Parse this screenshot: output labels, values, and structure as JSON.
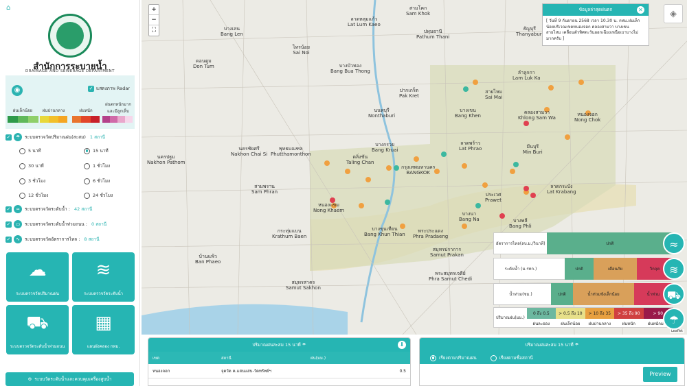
{
  "sidebar": {
    "org_th": "สำนักการระบายน้ำ",
    "org_en": "DRAINAGE AND SEWERAGE DEPARTMENT",
    "radar_toggle": "แสดงภาพ Radar",
    "legend": [
      "ฝนเล็กน้อย",
      "ฝนปานกลาง",
      "ฝนหนัก",
      "ฝนตกหนักมาก และมีลูกเห็บ"
    ],
    "rain_station": {
      "label": "ระบบตรวจวัดปริมาณฝน(สะสม)",
      "count": "1 สถานี"
    },
    "intervals": [
      "5 นาที",
      "15 นาที",
      "30 นาที",
      "1 ชั่วโมง",
      "3 ชั่วโมง",
      "6 ชั่วโมง",
      "12 ชั่วโมง",
      "24 ชั่วโมง"
    ],
    "water_level": {
      "label": "ระบบตรวจวัดระดับน้ำ :",
      "count": "42 สถานี"
    },
    "flood_level": {
      "label": "ระบบตรวจวัดระดับน้ำท่วมถนน :",
      "count": "0 สถานี"
    },
    "flow_rate": {
      "label": "ระบบตรวจวัดอัตราการไหล :",
      "count": "8 สถานี"
    },
    "tiles": [
      "ระบบตรวจวัดปริมาณฝน",
      "ระบบตรวจวัดระดับน้ำ",
      "ระบบตรวจวัดระดับน้ำท่วมถนน",
      "แผนผังคลอง กทม."
    ],
    "bottom_button": "ระบบวัดระดับน้ำและควบคุมเครื่องสูบน้ำ"
  },
  "map": {
    "zoom_in": "+",
    "zoom_out": "−",
    "fullscreen": "⛶",
    "popup": {
      "title": "ข้อมูลล่าสุดฝนตก",
      "body": "[ วันที่ 9 กันยายน 2568 เวลา 10.30 น. กทม.ฝนเล็กน้อยบริเวณเขตหนองจอก คลองสามวา บางเขน สายไหม เคลื่อนตัวทิศตะวันออกเฉียงเหนือเบาบางไม่มากครับ ]"
    },
    "labels": [
      {
        "t": "สามโคก\nSam Khok"
      },
      {
        "t": "บางบัวทอง\nBang Bua Thong"
      },
      {
        "t": "ปทุมธานี\nPathum Thani"
      },
      {
        "t": "นนทบุรี\nNonthaburi"
      },
      {
        "t": "ปากเกร็ด\nPak Kret"
      },
      {
        "t": "บางเขน\nBang Khen"
      },
      {
        "t": "มีนบุรี\nMin Buri"
      },
      {
        "t": "ลาดกระบัง\nLat Krabang"
      },
      {
        "t": "นครปฐม\nNakhon Pathom"
      },
      {
        "t": "สามพราน\nSam Phran"
      },
      {
        "t": "กระทุ่มแบน\nKrathum Baen"
      },
      {
        "t": "สมุทรสาคร\nSamut Sakhon"
      },
      {
        "t": "สมุทรปราการ\nSamut Prakan"
      },
      {
        "t": "พระประแดง\nPhra Pradaeng"
      },
      {
        "t": "กรุงเทพมหานคร\nBANGKOK"
      },
      {
        "t": "หนองจอก\nNong Chok"
      },
      {
        "t": "ลำลูกกา\nLam Luk Ka"
      },
      {
        "t": "ธัญบุรี\nThanyaburi"
      },
      {
        "t": "บ้านแพ้ว\nBan Phaeo"
      },
      {
        "t": "พระสมุทรเจดีย์\nPhra Samut Chedi"
      },
      {
        "t": "บางพลี\nBang Phli"
      },
      {
        "t": "ตลิ่งชัน\nTaling Chan"
      },
      {
        "t": "หนองแขม\nNong Khaem"
      },
      {
        "t": "บางขุนเทียน\nBang Khun Thian"
      },
      {
        "t": "ลาดพร้าว\nLat Phrao"
      },
      {
        "t": "สายไหม\nSai Mai"
      },
      {
        "t": "คลองสามวา\nKhlong Sam Wa"
      },
      {
        "t": "บางนา\nBang Na"
      },
      {
        "t": "ประเวศ\nPrawet"
      },
      {
        "t": "ไทรน้อย\nSai Noi"
      },
      {
        "t": "นครชัยศรี\nNakhon Chai Si"
      },
      {
        "t": "พุทธมณฑล\nPhutthamonthon"
      },
      {
        "t": "ดอนตูม\nDon Tum"
      },
      {
        "t": "บางเลน\nBang Len"
      },
      {
        "t": "ลาดหลุมแก้ว\nLat Lum Kaeo"
      },
      {
        "t": "บางกรวย\nBang Kruai"
      }
    ],
    "legend": {
      "flow": {
        "label": "อัตราการไหล(ลบ.ม./วินาที)",
        "segs": [
          "ปกติ"
        ]
      },
      "level": {
        "label": "ระดับน้ำ (ม.รทก.)",
        "segs": [
          "ปกติ",
          "เตือนภัย",
          "วิกฤต"
        ]
      },
      "flood": {
        "label": "น้ำท่วม(ซม.)",
        "segs": [
          "ปกติ",
          "น้ำท่วมขังเล็กน้อย",
          "น้ำท่วม"
        ]
      },
      "rain": {
        "label": "ปริมาณฝน(มม.)",
        "ranges": [
          "0 ถึง 0.5",
          "> 0.5 ถึง 10",
          "> 10 ถึง 35",
          "> 35 ถึง 90",
          "> 90"
        ],
        "names": [
          "ฝนละออง",
          "ฝนเล็กน้อย",
          "ฝนปานกลาง",
          "ฝนหนัก",
          "ฝนหนักมาก"
        ]
      }
    },
    "leaflet": "Leaflet"
  },
  "rain_panel": {
    "title": "ปริมาณฝนสะสม 15 นาที",
    "columns": [
      "เขต",
      "สถานี",
      "ฝน(มม.)"
    ],
    "rows": [
      {
        "district": "หนองจอก",
        "station": "จุดวัด ค.แสนแสบ-วัดทรัพย์ฯ",
        "rain": "0.5"
      }
    ]
  },
  "right_panel": {
    "title": "ปริมาณฝนสะสม 15 นาที",
    "sort1": "เรียงตามปริมาณฝน",
    "sort2": "เรียงตามชื่อสถานี",
    "preview": "Preview"
  },
  "colors": {
    "accent": "#26b5b3"
  }
}
